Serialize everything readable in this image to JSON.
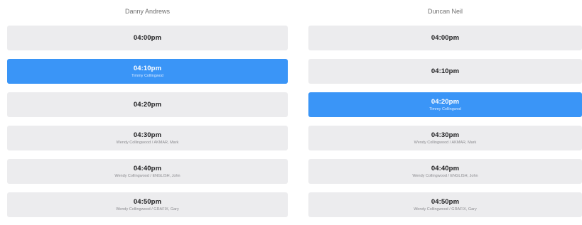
{
  "columns": [
    {
      "name": "Danny Andrews",
      "slots": [
        {
          "time": "04:00pm",
          "detail": "",
          "booked": false
        },
        {
          "time": "04:10pm",
          "detail": "Timmy Collingwod",
          "booked": true
        },
        {
          "time": "04:20pm",
          "detail": "",
          "booked": false
        },
        {
          "time": "04:30pm",
          "detail": "Wendy Collingwood / AKMAR, Mark",
          "booked": false
        },
        {
          "time": "04:40pm",
          "detail": "Wendy Collingwood / ENGLISH, John",
          "booked": false
        },
        {
          "time": "04:50pm",
          "detail": "Wendy Collingwood / GRAFIX, Gary",
          "booked": false
        }
      ]
    },
    {
      "name": "Duncan Neil",
      "slots": [
        {
          "time": "04:00pm",
          "detail": "",
          "booked": false
        },
        {
          "time": "04:10pm",
          "detail": "",
          "booked": false
        },
        {
          "time": "04:20pm",
          "detail": "Timmy Collingwod",
          "booked": true
        },
        {
          "time": "04:30pm",
          "detail": "Wendy Collingwood / AKMAR, Mark",
          "booked": false
        },
        {
          "time": "04:40pm",
          "detail": "Wendy Collingwood / ENGLISH, John",
          "booked": false
        },
        {
          "time": "04:50pm",
          "detail": "Wendy Collingwood / GRAFIX, Gary",
          "booked": false
        }
      ]
    }
  ],
  "colors": {
    "available": "#ececee",
    "booked": "#3a95f7",
    "header_text": "#6f6f6f"
  }
}
